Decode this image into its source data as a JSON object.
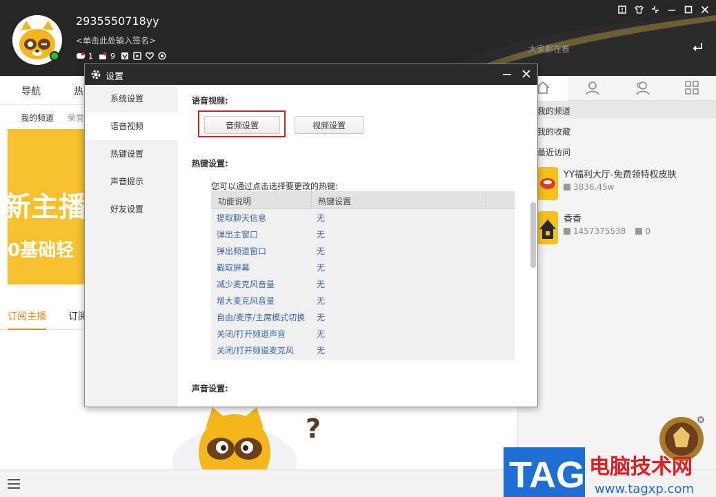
{
  "header": {
    "username": "2935550718yy",
    "signature": "<单击此处输入签名>",
    "badges": [
      {
        "icon": "gamepad-icon",
        "count": "1"
      },
      {
        "icon": "gift-icon",
        "count": "9"
      },
      {
        "icon": "vip-icon",
        "count": ""
      },
      {
        "icon": "video-icon",
        "count": ""
      },
      {
        "icon": "heart-icon",
        "count": ""
      },
      {
        "icon": "eye-icon",
        "count": ""
      }
    ],
    "search_placeholder": "大家都在看",
    "window_controls": [
      "feedback-icon",
      "skin-icon",
      "restore-window-icon",
      "minimize-icon",
      "maximize-icon",
      "close-icon"
    ]
  },
  "main": {
    "nav": [
      "导航",
      "热"
    ],
    "subnav": [
      "我的频道",
      "荣誉"
    ],
    "banner": {
      "line1": "新主播",
      "line2": "0基础轻"
    },
    "tabs": [
      {
        "label": "订阅主播",
        "active": true
      },
      {
        "label": "订阅",
        "active": false
      }
    ]
  },
  "right_panel": {
    "tabs": [
      "home-icon",
      "user-icon",
      "friends-icon",
      "apps-icon"
    ],
    "menu": [
      "我的频道",
      "我的收藏",
      "最近访问"
    ],
    "channels": [
      {
        "name": "YY福利大厅-免费领特权皮肤",
        "id": "",
        "count": "3836.45w"
      },
      {
        "name": "香香",
        "id": "1457375538",
        "count": "0"
      }
    ]
  },
  "dialog": {
    "title": "设置",
    "sidebar": [
      {
        "label": "系统设置",
        "active": false
      },
      {
        "label": "语音视频",
        "active": true
      },
      {
        "label": "热键设置",
        "active": false
      },
      {
        "label": "声音提示",
        "active": false
      },
      {
        "label": "好友设置",
        "active": false
      }
    ],
    "voice_video": {
      "title": "语音视频:",
      "audio_button": "音频设置",
      "video_button": "视频设置"
    },
    "hotkeys": {
      "title": "热键设置:",
      "hint": "您可以通过点击选择要更改的热键:",
      "col_function": "功能说明",
      "col_hotkey": "热键设置",
      "rows": [
        {
          "func": "提取聊天信息",
          "key": "无"
        },
        {
          "func": "弹出主窗口",
          "key": "无"
        },
        {
          "func": "弹出频道窗口",
          "key": "无"
        },
        {
          "func": "截取屏幕",
          "key": "无"
        },
        {
          "func": "减少麦克风音量",
          "key": "无"
        },
        {
          "func": "增大麦克风音量",
          "key": "无"
        },
        {
          "func": "自由/麦序/主席模式切换",
          "key": "无"
        },
        {
          "func": "关闭/打开频道声音",
          "key": "无"
        },
        {
          "func": "关闭/打开频道麦克风",
          "key": "无"
        }
      ]
    },
    "sound": {
      "title": "声音设置:"
    }
  },
  "watermark": {
    "brand": "TAG",
    "site_name": "电脑技术网",
    "url": "www.tagxp.com"
  },
  "colors": {
    "accent": "#f08c1f",
    "header_bg": "#262626",
    "highlight": "#e01b1b",
    "link": "#3a67b0"
  }
}
